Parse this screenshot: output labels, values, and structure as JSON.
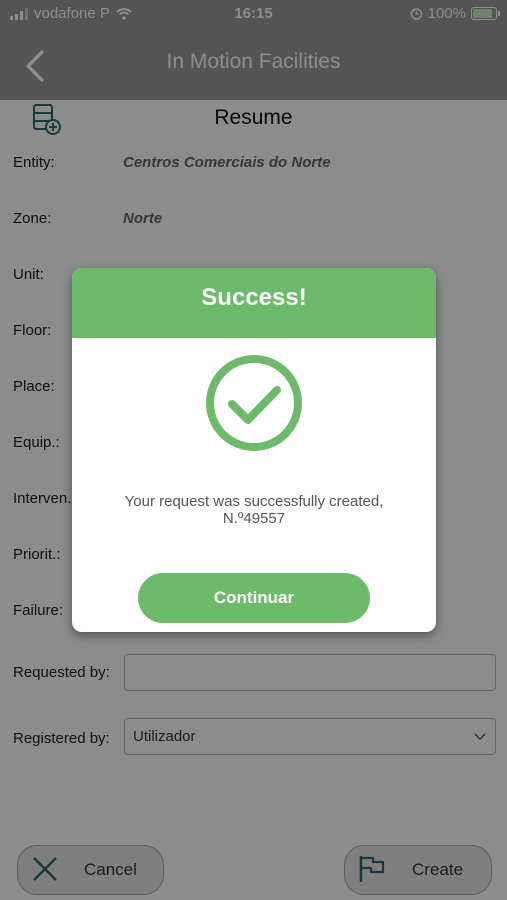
{
  "status_bar": {
    "carrier": "vodafone P",
    "time": "16:15",
    "battery": "100%"
  },
  "header": {
    "title": "In Motion Facilities"
  },
  "section": {
    "title": "Resume"
  },
  "form": {
    "entity_label": "Entity:",
    "entity_value": "Centros Comerciais do Norte",
    "zone_label": "Zone:",
    "zone_value": "Norte",
    "unit_label": "Unit:",
    "floor_label": "Floor:",
    "place_label": "Place:",
    "equip_label": "Equip.:",
    "interven_label": "Interven.",
    "priorit_label": "Priorit.:",
    "failure_label": "Failure:",
    "requested_by_label": "Requested by:",
    "requested_by_value": "",
    "registered_by_label": "Registered by:",
    "registered_by_value": "Utilizador"
  },
  "actions": {
    "cancel_label": "Cancel",
    "create_label": "Create"
  },
  "dialog": {
    "title": "Success!",
    "message_line1": "Your request was successfully created,",
    "message_line2": "N.º49557",
    "button_label": "Continuar"
  },
  "colors": {
    "accent_green": "#6dbb6a",
    "header_gray": "#9a9a9a"
  },
  "icons": [
    "back-chevron-icon",
    "add-record-icon",
    "check-circle-icon",
    "close-x-icon",
    "flag-icon",
    "chevron-down-icon",
    "wifi-icon",
    "alarm-icon",
    "battery-icon"
  ]
}
